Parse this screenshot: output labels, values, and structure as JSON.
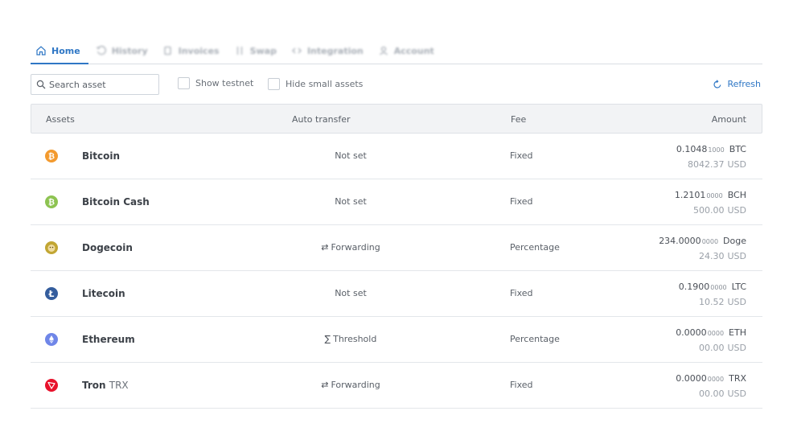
{
  "tabs": [
    {
      "label": "Home",
      "icon": "home-icon"
    },
    {
      "label": "History",
      "icon": "history-icon"
    },
    {
      "label": "Invoices",
      "icon": "invoices-icon"
    },
    {
      "label": "Swap",
      "icon": "swap-icon"
    },
    {
      "label": "Integration",
      "icon": "code-icon"
    },
    {
      "label": "Account",
      "icon": "user-icon"
    }
  ],
  "toolbar": {
    "search_placeholder": "Search asset",
    "show_testnet": "Show testnet",
    "hide_small": "Hide small assets",
    "refresh": "Refresh"
  },
  "table": {
    "headers": {
      "assets": "Assets",
      "auto": "Auto transfer",
      "fee": "Fee",
      "amount": "Amount"
    },
    "rows": [
      {
        "name": "Bitcoin",
        "sub": "",
        "auto_icon": "",
        "auto": "Not set",
        "fee": "Fixed",
        "amount_main": "0.1048",
        "amount_rest": "1000",
        "unit": "BTC",
        "fiat": "8042.37",
        "fiat_unit": "USD",
        "color": "#f39a2e",
        "icon": "bitcoin-icon"
      },
      {
        "name": "Bitcoin Cash",
        "sub": "",
        "auto_icon": "",
        "auto": "Not set",
        "fee": "Fixed",
        "amount_main": "1.2101",
        "amount_rest": "0000",
        "unit": "BCH",
        "fiat": "500.00",
        "fiat_unit": "USD",
        "color": "#8dc351",
        "icon": "bitcoin-cash-icon"
      },
      {
        "name": "Dogecoin",
        "sub": "",
        "auto_icon": "⇄",
        "auto": "Forwarding",
        "fee": "Percentage",
        "amount_main": "234.0000",
        "amount_rest": "0000",
        "unit": "Doge",
        "fiat": "24.30",
        "fiat_unit": "USD",
        "color": "#c2a633",
        "icon": "dogecoin-icon"
      },
      {
        "name": "Litecoin",
        "sub": "",
        "auto_icon": "",
        "auto": "Not set",
        "fee": "Fixed",
        "amount_main": "0.1900",
        "amount_rest": "0000",
        "unit": "LTC",
        "fiat": "10.52",
        "fiat_unit": "USD",
        "color": "#345d9d",
        "icon": "litecoin-icon"
      },
      {
        "name": "Ethereum",
        "sub": "",
        "auto_icon": "∑",
        "auto": "Threshold",
        "fee": "Percentage",
        "amount_main": "0.0000",
        "amount_rest": "0000",
        "unit": "ETH",
        "fiat": "00.00",
        "fiat_unit": "USD",
        "color": "#6f86e8",
        "icon": "ethereum-icon"
      },
      {
        "name": "Tron",
        "sub": "TRX",
        "auto_icon": "⇄",
        "auto": "Forwarding",
        "fee": "Fixed",
        "amount_main": "0.0000",
        "amount_rest": "0000",
        "unit": "TRX",
        "fiat": "00.00",
        "fiat_unit": "USD",
        "color": "#e8122b",
        "icon": "tron-icon"
      }
    ]
  },
  "colors": {
    "accent": "#2f77c5",
    "header_bg": "#f2f3f5"
  }
}
